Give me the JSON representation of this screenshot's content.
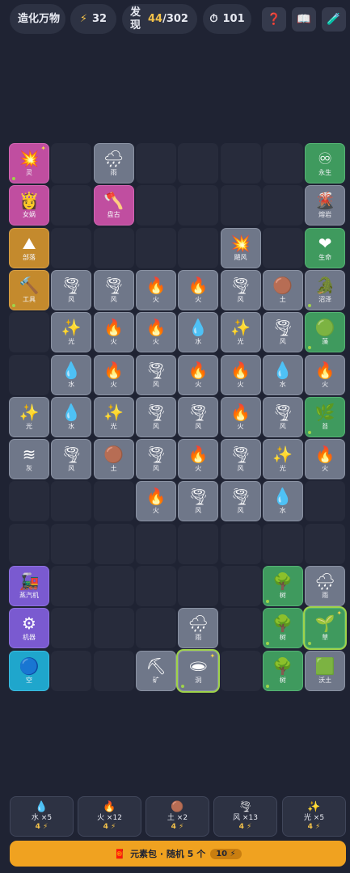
{
  "header": {
    "title": "造化万物",
    "energy_icon": "lightning-icon",
    "energy": "32",
    "found_label": "发现",
    "found_count": "44",
    "found_total": "/302",
    "timer_icon": "stopwatch-icon",
    "timer": "101",
    "help_icon": "❓",
    "book_icon": "📖",
    "brush_icon": "🧪"
  },
  "tiles": [
    {
      "col": 0,
      "row": 0,
      "icon": "💥",
      "name": "灵",
      "color": "pink",
      "dot": true,
      "spark": true
    },
    {
      "col": 2,
      "row": 0,
      "icon": "🌧",
      "name": "雨",
      "color": "gray"
    },
    {
      "col": 7,
      "row": 0,
      "icon": "♾",
      "name": "永生",
      "color": "green"
    },
    {
      "col": 0,
      "row": 1,
      "icon": "👸",
      "name": "女娲",
      "color": "pink"
    },
    {
      "col": 2,
      "row": 1,
      "icon": "🪓",
      "name": "盘古",
      "color": "pink"
    },
    {
      "col": 7,
      "row": 1,
      "icon": "🌋",
      "name": "熔岩",
      "color": "gray"
    },
    {
      "col": 0,
      "row": 2,
      "icon": "⛰",
      "name": "部落",
      "color": "orange"
    },
    {
      "col": 5,
      "row": 2,
      "icon": "💥",
      "name": "飓风",
      "color": "gray"
    },
    {
      "col": 7,
      "row": 2,
      "icon": "❤",
      "name": "生命",
      "color": "green"
    },
    {
      "col": 0,
      "row": 3,
      "icon": "🔨",
      "name": "工具",
      "color": "orange",
      "dot": true
    },
    {
      "col": 1,
      "row": 3,
      "icon": "🌪",
      "name": "风",
      "color": "gray"
    },
    {
      "col": 2,
      "row": 3,
      "icon": "🌪",
      "name": "风",
      "color": "gray"
    },
    {
      "col": 3,
      "row": 3,
      "icon": "🔥",
      "name": "火",
      "color": "gray"
    },
    {
      "col": 4,
      "row": 3,
      "icon": "🔥",
      "name": "火",
      "color": "gray"
    },
    {
      "col": 5,
      "row": 3,
      "icon": "🌪",
      "name": "风",
      "color": "gray"
    },
    {
      "col": 6,
      "row": 3,
      "icon": "🟤",
      "name": "土",
      "color": "gray"
    },
    {
      "col": 7,
      "row": 3,
      "icon": "🐊",
      "name": "沼泽",
      "color": "gray",
      "dot": true
    },
    {
      "col": 1,
      "row": 4,
      "icon": "✨",
      "name": "光",
      "color": "gray"
    },
    {
      "col": 2,
      "row": 4,
      "icon": "🔥",
      "name": "火",
      "color": "gray"
    },
    {
      "col": 3,
      "row": 4,
      "icon": "🔥",
      "name": "火",
      "color": "gray"
    },
    {
      "col": 4,
      "row": 4,
      "icon": "💧",
      "name": "水",
      "color": "gray"
    },
    {
      "col": 5,
      "row": 4,
      "icon": "✨",
      "name": "光",
      "color": "gray"
    },
    {
      "col": 6,
      "row": 4,
      "icon": "🌪",
      "name": "风",
      "color": "gray"
    },
    {
      "col": 7,
      "row": 4,
      "icon": "🟢",
      "name": "藻",
      "color": "green",
      "dot": true
    },
    {
      "col": 1,
      "row": 5,
      "icon": "💧",
      "name": "水",
      "color": "gray"
    },
    {
      "col": 2,
      "row": 5,
      "icon": "🔥",
      "name": "火",
      "color": "gray"
    },
    {
      "col": 3,
      "row": 5,
      "icon": "🌪",
      "name": "风",
      "color": "gray"
    },
    {
      "col": 4,
      "row": 5,
      "icon": "🔥",
      "name": "火",
      "color": "gray"
    },
    {
      "col": 5,
      "row": 5,
      "icon": "🔥",
      "name": "火",
      "color": "gray"
    },
    {
      "col": 6,
      "row": 5,
      "icon": "💧",
      "name": "水",
      "color": "gray"
    },
    {
      "col": 7,
      "row": 5,
      "icon": "🔥",
      "name": "火",
      "color": "gray"
    },
    {
      "col": 0,
      "row": 6,
      "icon": "✨",
      "name": "光",
      "color": "gray"
    },
    {
      "col": 1,
      "row": 6,
      "icon": "💧",
      "name": "水",
      "color": "gray"
    },
    {
      "col": 2,
      "row": 6,
      "icon": "✨",
      "name": "光",
      "color": "gray"
    },
    {
      "col": 3,
      "row": 6,
      "icon": "🌪",
      "name": "风",
      "color": "gray"
    },
    {
      "col": 4,
      "row": 6,
      "icon": "🌪",
      "name": "风",
      "color": "gray"
    },
    {
      "col": 5,
      "row": 6,
      "icon": "🔥",
      "name": "火",
      "color": "gray"
    },
    {
      "col": 6,
      "row": 6,
      "icon": "🌪",
      "name": "风",
      "color": "gray"
    },
    {
      "col": 7,
      "row": 6,
      "icon": "🌿",
      "name": "苔",
      "color": "green",
      "dot": true
    },
    {
      "col": 0,
      "row": 7,
      "icon": "≋",
      "name": "灰",
      "color": "gray"
    },
    {
      "col": 1,
      "row": 7,
      "icon": "🌪",
      "name": "风",
      "color": "gray"
    },
    {
      "col": 2,
      "row": 7,
      "icon": "🟤",
      "name": "土",
      "color": "gray"
    },
    {
      "col": 3,
      "row": 7,
      "icon": "🌪",
      "name": "风",
      "color": "gray"
    },
    {
      "col": 4,
      "row": 7,
      "icon": "🔥",
      "name": "火",
      "color": "gray"
    },
    {
      "col": 5,
      "row": 7,
      "icon": "🌪",
      "name": "风",
      "color": "gray"
    },
    {
      "col": 6,
      "row": 7,
      "icon": "✨",
      "name": "光",
      "color": "gray"
    },
    {
      "col": 7,
      "row": 7,
      "icon": "🔥",
      "name": "火",
      "color": "gray"
    },
    {
      "col": 3,
      "row": 8,
      "icon": "🔥",
      "name": "火",
      "color": "gray"
    },
    {
      "col": 4,
      "row": 8,
      "icon": "🌪",
      "name": "风",
      "color": "gray"
    },
    {
      "col": 5,
      "row": 8,
      "icon": "🌪",
      "name": "风",
      "color": "gray"
    },
    {
      "col": 6,
      "row": 8,
      "icon": "💧",
      "name": "水",
      "color": "gray"
    },
    {
      "col": 0,
      "row": 10,
      "icon": "🚂",
      "name": "蒸汽机",
      "color": "purple"
    },
    {
      "col": 6,
      "row": 10,
      "icon": "🌳",
      "name": "树",
      "color": "green",
      "dot": true
    },
    {
      "col": 7,
      "row": 10,
      "icon": "🌧",
      "name": "雨",
      "color": "gray"
    },
    {
      "col": 0,
      "row": 11,
      "icon": "⚙",
      "name": "机器",
      "color": "purple"
    },
    {
      "col": 4,
      "row": 11,
      "icon": "🌧",
      "name": "雨",
      "color": "gray"
    },
    {
      "col": 6,
      "row": 11,
      "icon": "🌳",
      "name": "树",
      "color": "green",
      "dot": true
    },
    {
      "col": 7,
      "row": 11,
      "icon": "🌱",
      "name": "草",
      "color": "green",
      "dot": true,
      "spark": true,
      "selected": true
    },
    {
      "col": 0,
      "row": 12,
      "icon": "🔵",
      "name": "空",
      "color": "cyan"
    },
    {
      "col": 3,
      "row": 12,
      "icon": "⛏",
      "name": "矿",
      "color": "gray"
    },
    {
      "col": 4,
      "row": 12,
      "icon": "🕳",
      "name": "洞",
      "color": "gray",
      "dot": true,
      "spark": true,
      "selected": true
    },
    {
      "col": 6,
      "row": 12,
      "icon": "🌳",
      "name": "树",
      "color": "green",
      "dot": true
    },
    {
      "col": 7,
      "row": 12,
      "icon": "🟩",
      "name": "沃土",
      "color": "gray"
    }
  ],
  "tray": [
    {
      "icon": "💧",
      "name": "水 ×5",
      "cost": "4 ⚡"
    },
    {
      "icon": "🔥",
      "name": "火 ×12",
      "cost": "4 ⚡"
    },
    {
      "icon": "🟤",
      "name": "土 ×2",
      "cost": "4 ⚡"
    },
    {
      "icon": "🌪",
      "name": "风 ×13",
      "cost": "4 ⚡"
    },
    {
      "icon": "✨",
      "name": "光 ×5",
      "cost": "4 ⚡"
    }
  ],
  "pack": {
    "icon": "🧧",
    "label": "元素包 · 随机 5 个",
    "cost": "10 ⚡"
  }
}
